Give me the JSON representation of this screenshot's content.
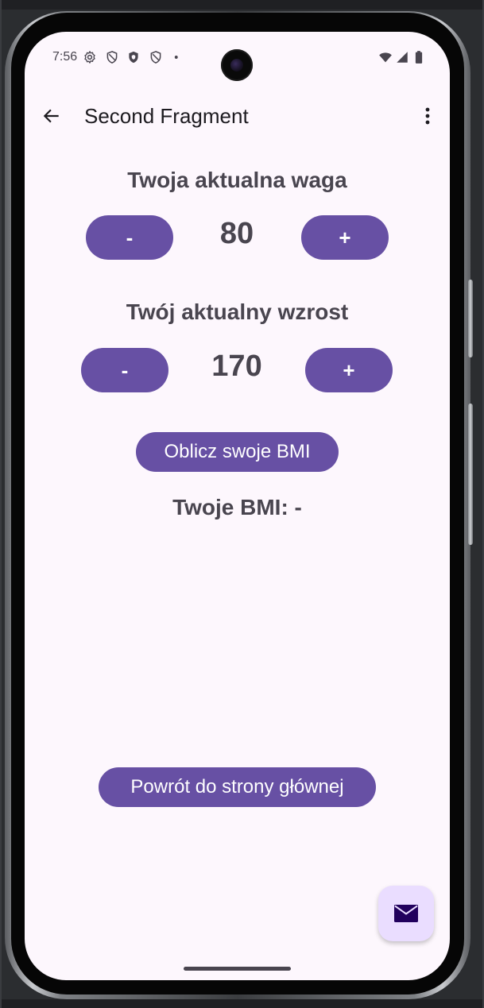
{
  "status_bar": {
    "time": "7:56",
    "icons": [
      "settings-icon",
      "shield-outline-icon",
      "shield-filled-icon",
      "shield-outline-icon",
      "notification-dot-icon",
      "wifi-icon",
      "signal-icon",
      "battery-icon"
    ]
  },
  "toolbar": {
    "title": "Second Fragment",
    "back_icon": "arrow-back-icon",
    "overflow_icon": "more-vert-icon"
  },
  "weight": {
    "heading": "Twoja aktualna waga",
    "value": "80",
    "decrement_label": "-",
    "increment_label": "+"
  },
  "height": {
    "heading": "Twój aktualny wzrost",
    "value": "170",
    "decrement_label": "-",
    "increment_label": "+"
  },
  "calculate_button": "Oblicz swoje BMI",
  "bmi_result": "Twoje BMI: -",
  "back_home_button": "Powrót do strony głównej",
  "fab": {
    "icon": "mail-icon"
  },
  "colors": {
    "primary": "#6750a4",
    "background": "#fdf7fd",
    "text": "#49454f",
    "fab_background": "#eaddff"
  }
}
